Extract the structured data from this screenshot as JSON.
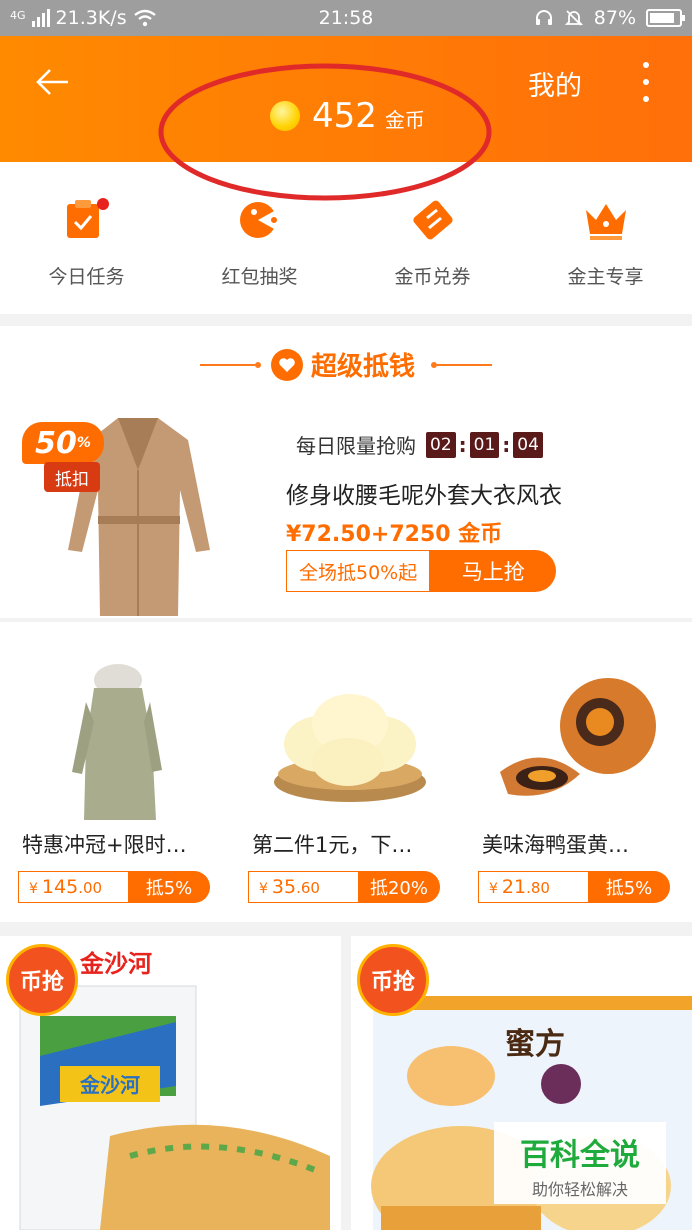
{
  "status_bar": {
    "network": "4G",
    "speed": "21.3K/s",
    "time": "21:58",
    "battery": "87%",
    "battery_level": 0.87
  },
  "header": {
    "mine_label": "我的",
    "coin_amount": "452",
    "coin_unit": "金币"
  },
  "quick_actions": [
    {
      "label": "今日任务",
      "icon": "task-icon"
    },
    {
      "label": "红包抽奖",
      "icon": "lottery-icon"
    },
    {
      "label": "金币兑券",
      "icon": "coupon-icon"
    },
    {
      "label": "金主专享",
      "icon": "crown-icon"
    }
  ],
  "super_deal": {
    "title": "超级抵钱",
    "badge_percent": "50",
    "badge_percent_sign": "%",
    "badge_text": "抵扣",
    "daily_label": "每日限量抢购",
    "countdown": [
      "02",
      "01",
      "04"
    ],
    "product_name": "修身收腰毛呢外套大衣风衣",
    "price": "¥72.50+7250 金币",
    "tag": "全场抵50%起",
    "buy_label": "马上抢"
  },
  "products": [
    {
      "name": "特惠冲冠+限时…",
      "currency": "¥",
      "price_int": "145",
      "price_dec": ".00",
      "discount": "抵5%"
    },
    {
      "name": "第二件1元，下…",
      "currency": "¥",
      "price_int": "35",
      "price_dec": ".60",
      "discount": "抵20%"
    },
    {
      "name": "美味海鸭蛋黄…",
      "currency": "¥",
      "price_int": "21",
      "price_dec": ".80",
      "discount": "抵5%"
    }
  ],
  "cards": [
    {
      "badge": "币抢",
      "brand": "金沙河"
    },
    {
      "badge": "币抢",
      "brand": "蜜方"
    }
  ],
  "watermark": {
    "title": "百科全说",
    "subtitle": "助你轻松解决"
  },
  "colors": {
    "accent": "#ff6d00",
    "header_start": "#ff8a00",
    "countdown_bg": "#5a1a1a",
    "annotation_red": "#e02a2a"
  }
}
